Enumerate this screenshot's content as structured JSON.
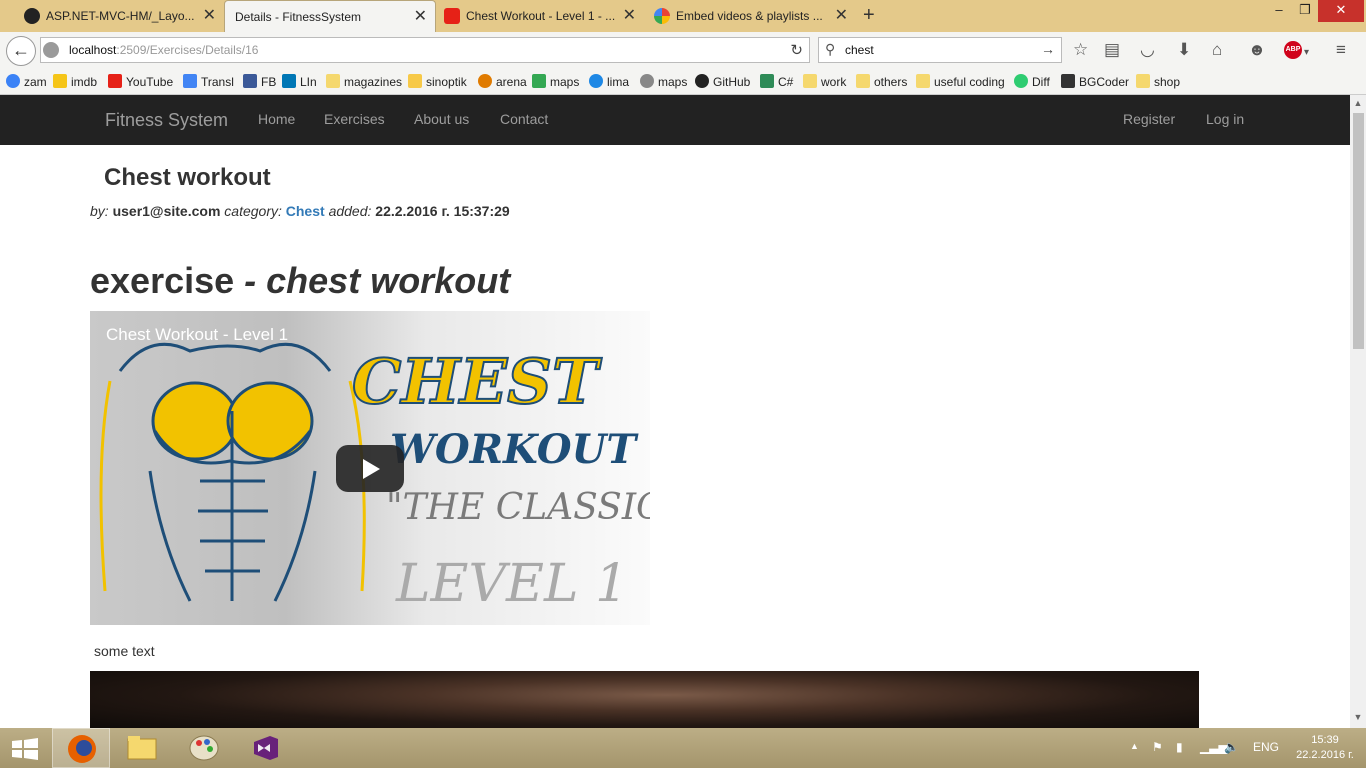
{
  "tabs": [
    {
      "label": "ASP.NET-MVC-HM/_Layo...",
      "icon": "github-icon"
    },
    {
      "label": "Details - FitnessSystem",
      "icon": "page-icon"
    },
    {
      "label": "Chest Workout - Level 1 - ...",
      "icon": "youtube-icon"
    },
    {
      "label": "Embed videos & playlists ...",
      "icon": "google-icon"
    }
  ],
  "new_tab": "+",
  "window_controls": {
    "minimize": "–",
    "maximize": "❐",
    "close": "✕"
  },
  "url": {
    "host": "localhost",
    "rest": ":2509/Exercises/Details/16"
  },
  "search": {
    "value": "chest"
  },
  "bookmarks": [
    "zam",
    "imdb",
    "YouTube",
    "Transl",
    "FB",
    "LIn",
    "magazines",
    "sinoptik",
    "arena",
    "maps",
    "lima",
    "maps",
    "GitHub",
    "C#",
    "work",
    "others",
    "useful coding",
    "Diff",
    "BGCoder",
    "shop"
  ],
  "site": {
    "brand": "Fitness System",
    "nav": [
      "Home",
      "Exercises",
      "About us",
      "Contact"
    ],
    "auth": [
      "Register",
      "Log in"
    ]
  },
  "page": {
    "title": "Chest workout",
    "meta": {
      "by_label": "by:",
      "author": "user1@site.com",
      "category_label": "category:",
      "category": "Chest",
      "added_label": "added:",
      "added": "22.2.2016 г. 15:37:29"
    },
    "heading_bold": "exercise",
    "heading_italic": "- chest workout",
    "video": {
      "title": "Chest Workout - Level 1",
      "art": {
        "line1": "CHEST",
        "line2": "WORKOUT",
        "line3": "\"THE CLASSIC\"",
        "line4": "LEVEL 1"
      }
    },
    "body_text": "some text"
  },
  "tray": {
    "lang": "ENG",
    "time": "15:39",
    "date": "22.2.2016 г."
  },
  "colors": {
    "navbar": "#222222",
    "link": "#337ab7",
    "tabstrip": "#e4c98a",
    "art_yellow": "#f2c200",
    "art_blue": "#1e4e78"
  }
}
